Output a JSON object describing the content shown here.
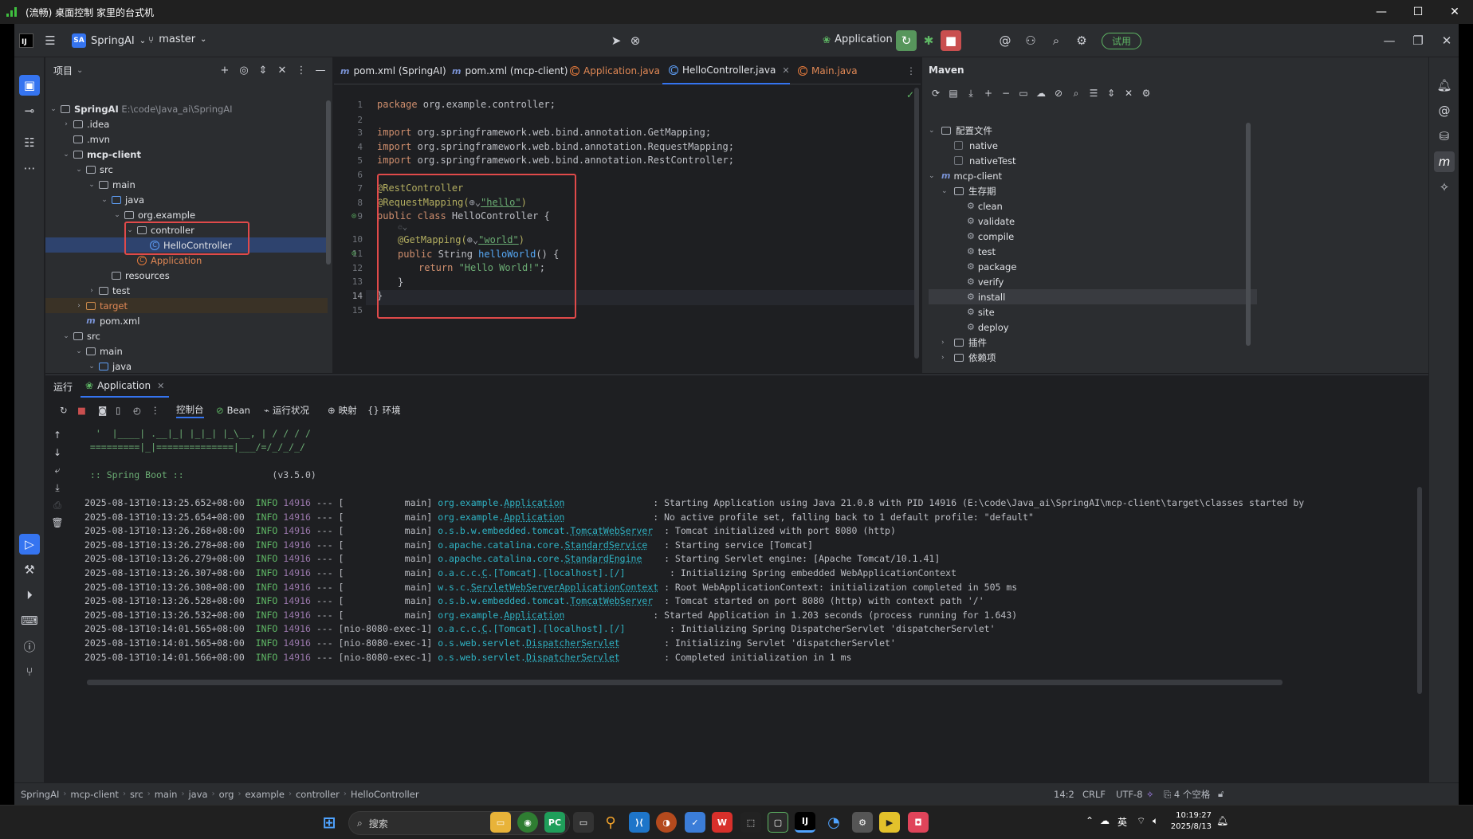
{
  "window": {
    "title": "(流畅) 桌面控制 家里的台式机"
  },
  "toolbar": {
    "project_badge": "SA",
    "project_name": "SpringAI",
    "branch": "master",
    "run_config": "Application",
    "trial_label": "试用"
  },
  "project_panel": {
    "title": "项目",
    "rows": [
      {
        "label": "SpringAI",
        "hint": "E:\\code\\Java_ai\\SpringAI"
      },
      {
        "label": ".idea"
      },
      {
        "label": ".mvn"
      },
      {
        "label": "mcp-client"
      },
      {
        "label": "src"
      },
      {
        "label": "main"
      },
      {
        "label": "java"
      },
      {
        "label": "org.example"
      },
      {
        "label": "controller"
      },
      {
        "label": "HelloController"
      },
      {
        "label": "Application"
      },
      {
        "label": "resources"
      },
      {
        "label": "test"
      },
      {
        "label": "target"
      },
      {
        "label": "pom.xml"
      },
      {
        "label": "src"
      },
      {
        "label": "main"
      },
      {
        "label": "java"
      }
    ]
  },
  "editor": {
    "tabs": [
      {
        "label": "pom.xml (SpringAI)"
      },
      {
        "label": "pom.xml (mcp-client)"
      },
      {
        "label": "Application.java"
      },
      {
        "label": "HelloController.java"
      },
      {
        "label": "Main.java"
      }
    ],
    "line_numbers": [
      "1",
      "2",
      "3",
      "4",
      "5",
      "6",
      "7",
      "8",
      "9",
      "10",
      "11",
      "12",
      "13",
      "14",
      "15"
    ],
    "code": {
      "l1_kw": "package",
      "l1_rest": " org.example.controller;",
      "imp_kw": "import",
      "l3": " org.springframework.web.bind.annotation.GetMapping;",
      "l4": " org.springframework.web.bind.annotation.RequestMapping;",
      "l5": " org.springframework.web.bind.annotation.RestController;",
      "l7": "@RestController",
      "l8_ann": "@RequestMapping(",
      "l8_str": "\"hello\"",
      "l8_end": ")",
      "l9_kw": "public class",
      "l9_rest": " HelloController {",
      "l10_ann": "@GetMapping(",
      "l10_str": "\"world\"",
      "l10_end": ")",
      "l11_kw": "public",
      "l11_mid": " String ",
      "l11_fn": "helloWorld",
      "l11_end": "() {",
      "l12_kw": "return",
      "l12_str": " \"Hello World!\"",
      "l12_end": ";",
      "l13": "}",
      "l14": "}"
    }
  },
  "maven": {
    "title": "Maven",
    "rows": [
      "配置文件",
      "native",
      "nativeTest",
      "mcp-client",
      "生存期",
      "clean",
      "validate",
      "compile",
      "test",
      "package",
      "verify",
      "install",
      "site",
      "deploy",
      "插件",
      "依赖项"
    ]
  },
  "run": {
    "tab_label": "运行",
    "app_tab": "Application",
    "toolbar_tabs": [
      "控制台",
      "Bean",
      "运行状况",
      "映射",
      "环境"
    ],
    "banner": [
      "  '  |____| .__|_| |_|_| |_\\__, | / / / /",
      " =========|_|==============|___/=/_/_/_/"
    ],
    "spring_boot_label": " :: Spring Boot :: ",
    "spring_boot_version": "(v3.5.0)",
    "log": [
      {
        "ts": "2025-08-13T10:13:25.652+08:00",
        "level": "INFO",
        "pid": "14916",
        "sep": "--- [",
        "thread": "           main] ",
        "pkg": "org.example.",
        "cls": "Application",
        "pad": "                ",
        "msg": ": Starting Application using Java 21.0.8 with PID 14916 (E:\\code\\Java_ai\\SpringAI\\mcp-client\\target\\classes started by"
      },
      {
        "ts": "2025-08-13T10:13:25.654+08:00",
        "level": "INFO",
        "pid": "14916",
        "sep": "--- [",
        "thread": "           main] ",
        "pkg": "org.example.",
        "cls": "Application",
        "pad": "                ",
        "msg": ": No active profile set, falling back to 1 default profile: \"default\""
      },
      {
        "ts": "2025-08-13T10:13:26.268+08:00",
        "level": "INFO",
        "pid": "14916",
        "sep": "--- [",
        "thread": "           main] ",
        "pkg": "o.s.b.w.embedded.tomcat.",
        "cls": "TomcatWebServer",
        "pad": "  ",
        "msg": ": Tomcat initialized with port 8080 (http)"
      },
      {
        "ts": "2025-08-13T10:13:26.278+08:00",
        "level": "INFO",
        "pid": "14916",
        "sep": "--- [",
        "thread": "           main] ",
        "pkg": "o.apache.catalina.core.",
        "cls": "StandardService",
        "pad": "   ",
        "msg": ": Starting service [Tomcat]"
      },
      {
        "ts": "2025-08-13T10:13:26.279+08:00",
        "level": "INFO",
        "pid": "14916",
        "sep": "--- [",
        "thread": "           main] ",
        "pkg": "o.apache.catalina.core.",
        "cls": "StandardEngine",
        "pad": "    ",
        "msg": ": Starting Servlet engine: [Apache Tomcat/10.1.41]"
      },
      {
        "ts": "2025-08-13T10:13:26.307+08:00",
        "level": "INFO",
        "pid": "14916",
        "sep": "--- [",
        "thread": "           main] ",
        "pkg": "o.a.c.c.",
        "cls": "C",
        "pad": ".[Tomcat].[localhost].[/]        ",
        "msg": ": Initializing Spring embedded WebApplicationContext"
      },
      {
        "ts": "2025-08-13T10:13:26.308+08:00",
        "level": "INFO",
        "pid": "14916",
        "sep": "--- [",
        "thread": "           main] ",
        "pkg": "w.s.c.",
        "cls": "ServletWebServerApplicationContext",
        "pad": " ",
        "msg": ": Root WebApplicationContext: initialization completed in 505 ms"
      },
      {
        "ts": "2025-08-13T10:13:26.528+08:00",
        "level": "INFO",
        "pid": "14916",
        "sep": "--- [",
        "thread": "           main] ",
        "pkg": "o.s.b.w.embedded.tomcat.",
        "cls": "TomcatWebServer",
        "pad": "  ",
        "msg": ": Tomcat started on port 8080 (http) with context path '/'"
      },
      {
        "ts": "2025-08-13T10:13:26.532+08:00",
        "level": "INFO",
        "pid": "14916",
        "sep": "--- [",
        "thread": "           main] ",
        "pkg": "org.example.",
        "cls": "Application",
        "pad": "                ",
        "msg": ": Started Application in 1.203 seconds (process running for 1.643)"
      },
      {
        "ts": "2025-08-13T10:14:01.565+08:00",
        "level": "INFO",
        "pid": "14916",
        "sep": "--- [",
        "thread": "nio-8080-exec-1] ",
        "pkg": "o.a.c.c.",
        "cls": "C",
        "pad": ".[Tomcat].[localhost].[/]        ",
        "msg": ": Initializing Spring DispatcherServlet 'dispatcherServlet'"
      },
      {
        "ts": "2025-08-13T10:14:01.565+08:00",
        "level": "INFO",
        "pid": "14916",
        "sep": "--- [",
        "thread": "nio-8080-exec-1] ",
        "pkg": "o.s.web.servlet.",
        "cls": "DispatcherServlet",
        "pad": "        ",
        "msg": ": Initializing Servlet 'dispatcherServlet'"
      },
      {
        "ts": "2025-08-13T10:14:01.566+08:00",
        "level": "INFO",
        "pid": "14916",
        "sep": "--- [",
        "thread": "nio-8080-exec-1] ",
        "pkg": "o.s.web.servlet.",
        "cls": "DispatcherServlet",
        "pad": "        ",
        "msg": ": Completed initialization in 1 ms"
      }
    ]
  },
  "statusbar": {
    "breadcrumbs": [
      "SpringAI",
      "mcp-client",
      "src",
      "main",
      "java",
      "org",
      "example",
      "controller",
      "HelloController"
    ],
    "position": "14:2",
    "line_sep": "CRLF",
    "encoding": "UTF-8",
    "indent": "4 个空格"
  },
  "taskbar": {
    "search_placeholder": "搜索",
    "ime": "英",
    "time": "10:19:27",
    "date": "2025/8/13"
  },
  "colors": {
    "accent": "#3574f0",
    "highlight_box": "#e04a4a",
    "run_green": "#57965c",
    "stop_red": "#c94f4f"
  }
}
